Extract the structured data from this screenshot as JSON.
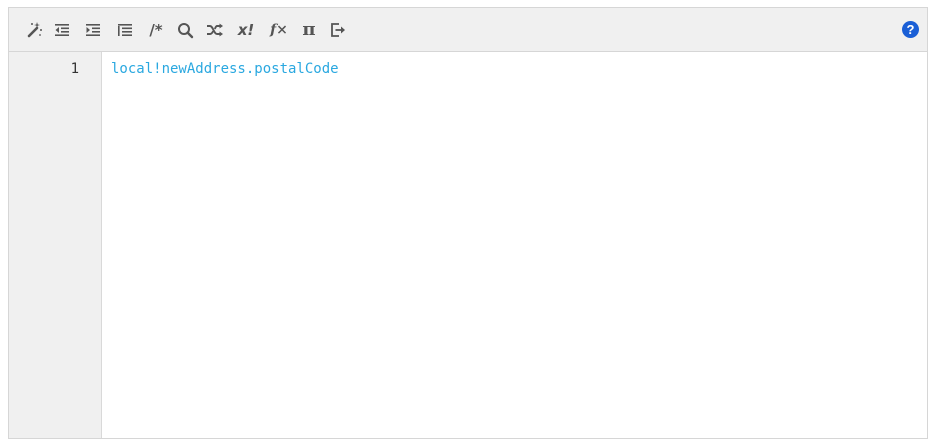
{
  "toolbar": {
    "buttons": [
      {
        "name": "format-wand-icon"
      },
      {
        "name": "outdent-icon"
      },
      {
        "name": "indent-icon"
      },
      {
        "name": "align-icon"
      },
      {
        "name": "comment-toggle",
        "label": "/*"
      },
      {
        "name": "search-icon"
      },
      {
        "name": "shuffle-icon"
      },
      {
        "name": "evaluate-button",
        "label": "x!"
      },
      {
        "name": "function-button",
        "label": "f×"
      },
      {
        "name": "constant-button",
        "label": "π"
      },
      {
        "name": "exit-icon"
      }
    ],
    "help_label": "?",
    "help_color": "#1a5fd6"
  },
  "editor": {
    "line_numbers": [
      "1"
    ],
    "lines": [
      "local!newAddress.postalCode"
    ],
    "code_color": "#2aa8e0"
  }
}
